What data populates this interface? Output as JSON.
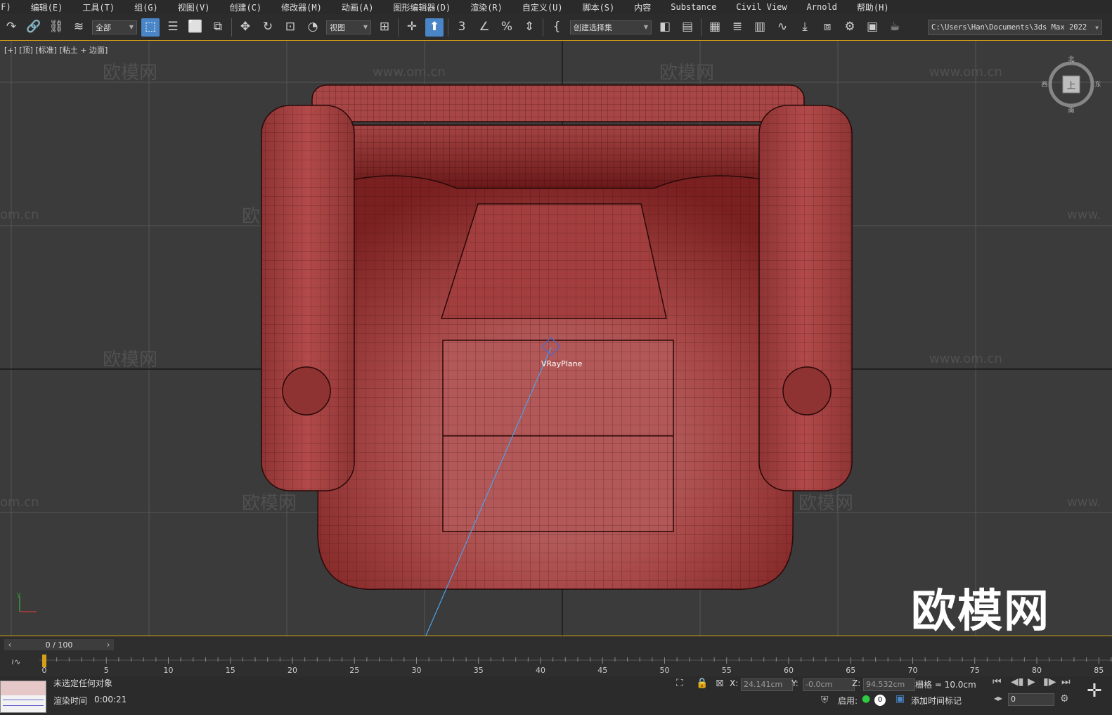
{
  "menu": [
    "(F)",
    "编辑(E)",
    "工具(T)",
    "组(G)",
    "视图(V)",
    "创建(C)",
    "修改器(M)",
    "动画(A)",
    "图形编辑器(D)",
    "渲染(R)",
    "自定义(U)",
    "脚本(S)",
    "内容",
    "Substance",
    "Civil View",
    "Arnold",
    "帮助(H)"
  ],
  "toolbar": {
    "selection_filter": "全部",
    "reference_coord": "视图",
    "named_selection": "创建选择集",
    "project_path": "C:\\Users\\Han\\Documents\\3ds Max 2022"
  },
  "viewport": {
    "label": "[+] [顶] [标准] [粘土 + 边面]",
    "object_label": "VRayPlane",
    "watermark_url": "www.om.cn",
    "watermark_url_cut": "om.cn",
    "watermark_url_cut_right": "www.",
    "watermark_cn": "欧模网",
    "viewcube": {
      "n": "北",
      "s": "南",
      "e": "东",
      "w": "西",
      "face": "上"
    },
    "mesh_color": "#b24a4a",
    "grid_color": "#555555"
  },
  "timeline": {
    "frame_display": "0 / 100",
    "ticks": [
      0,
      5,
      10,
      15,
      20,
      25,
      30,
      35,
      40,
      45,
      50,
      55,
      60,
      65,
      70,
      75,
      80,
      85
    ]
  },
  "status": {
    "selection_text": "未选定任何对象",
    "render_time_label": "渲染时间",
    "render_time": "0:00:21",
    "x_label": "X:",
    "x_value": "24.141cm",
    "y_label": "Y:",
    "y_value": "-0.0cm",
    "z_label": "Z:",
    "z_value": "94.532cm",
    "grid_text": "栅格 = 10.0cm",
    "enable_label": "启用:",
    "enable_count": "0",
    "add_time_tag": "添加时间标记",
    "frame_field": "0"
  },
  "accent_color": "#4a86c7",
  "timeline_border_color": "#d4a017"
}
